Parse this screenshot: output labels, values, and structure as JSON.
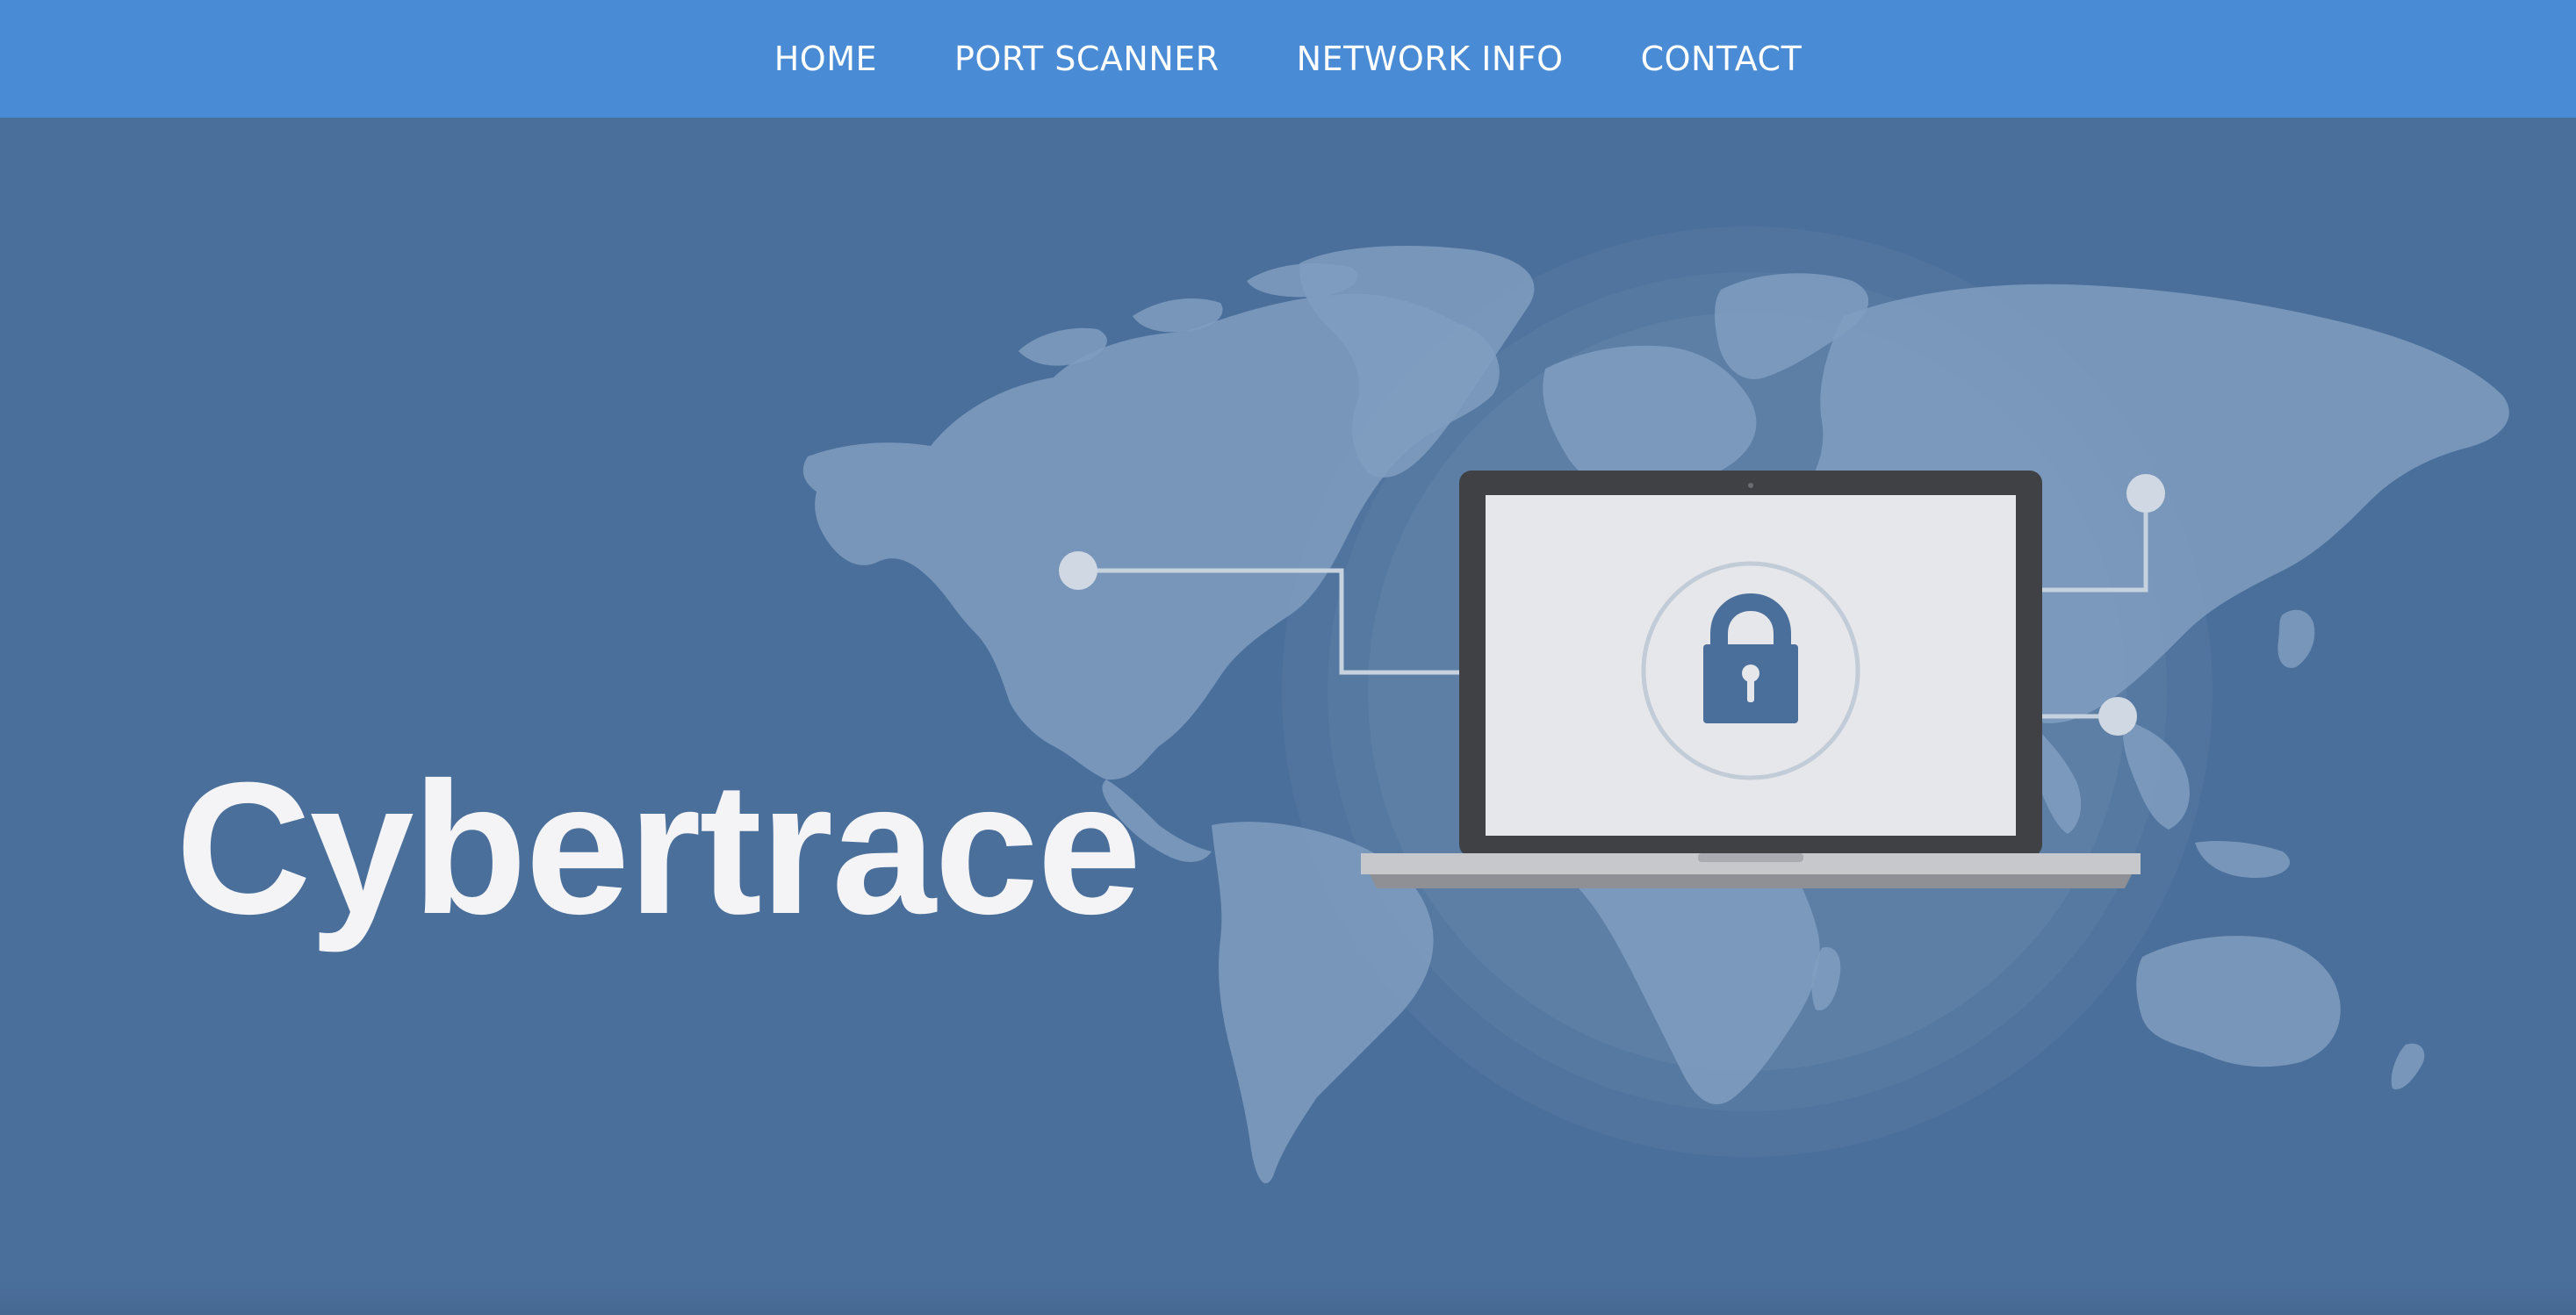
{
  "nav": {
    "items": [
      {
        "label": "HOME"
      },
      {
        "label": "PORT SCANNER"
      },
      {
        "label": "NETWORK INFO"
      },
      {
        "label": "CONTACT"
      }
    ]
  },
  "hero": {
    "title": "Cybertrace",
    "illustration": {
      "icons": [
        "world-map",
        "laptop-icon",
        "padlock-icon",
        "network-node-icon"
      ]
    }
  },
  "colors": {
    "navbar": "#4a8bd6",
    "hero_background": "#4a6f9b",
    "map_land": "#7f9ebf",
    "laptop_bezel": "#3f4145",
    "laptop_screen": "#e6e7ea",
    "lock": "#4a6f9b",
    "title_text": "#f4f4f6"
  }
}
